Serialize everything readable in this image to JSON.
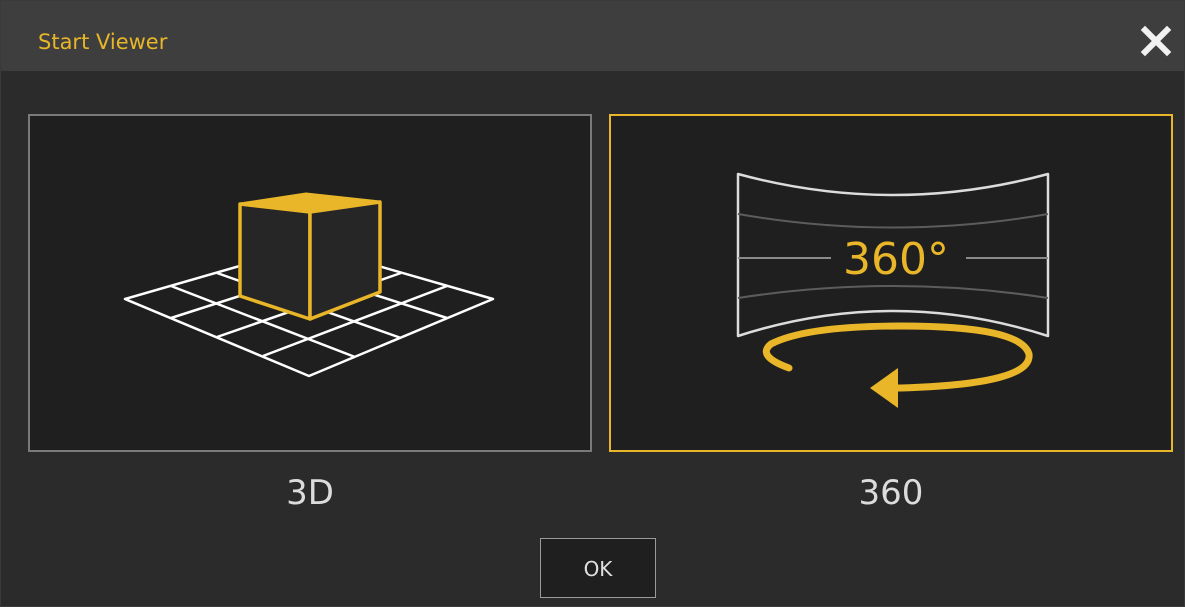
{
  "window": {
    "title": "Start Viewer",
    "close_icon": "close-icon"
  },
  "options": [
    {
      "id": "3d",
      "label": "3D",
      "icon": "cube-on-grid-icon",
      "selected": false
    },
    {
      "id": "360",
      "label": "360",
      "icon": "panorama-360-icon",
      "icon_text": "360°",
      "selected": true
    }
  ],
  "ok_button": {
    "label": "OK"
  },
  "colors": {
    "accent": "#e8b628",
    "background": "#2b2b2b",
    "titlebar": "#3e3e3e",
    "panel": "#1f1f1f",
    "text": "#dcdcdc"
  }
}
